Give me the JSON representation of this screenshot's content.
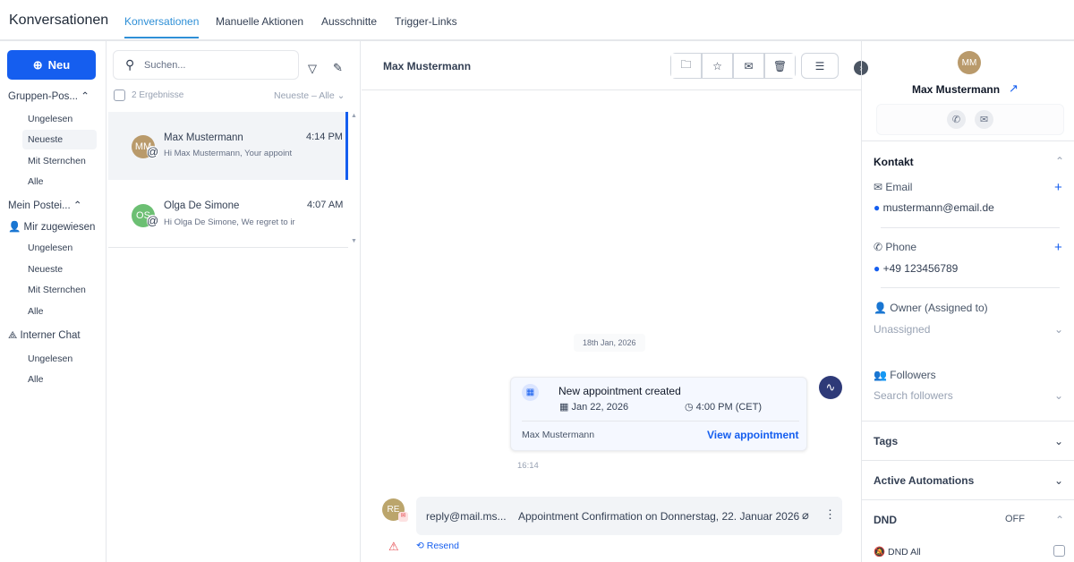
{
  "header": {
    "title": "Konversationen",
    "tabs": [
      "Konversationen",
      "Manuelle Aktionen",
      "Ausschnitte",
      "Trigger-Links"
    ]
  },
  "sidebar": {
    "new_label": "Neu",
    "group_label": "Gruppen-Pos...",
    "group_items": [
      "Ungelesen",
      "Neueste",
      "Mit Sternchen",
      "Alle"
    ],
    "inbox_label": "Mein Postei...",
    "assigned_label": "Mir zugewiesen",
    "assigned_items": [
      "Ungelesen",
      "Neueste",
      "Mit Sternchen",
      "Alle"
    ],
    "internal_label": "Interner Chat",
    "internal_items": [
      "Ungelesen",
      "Alle"
    ]
  },
  "list": {
    "search_placeholder": "Suchen...",
    "results": "2 Ergebnisse",
    "sort": "Neueste – Alle",
    "conversations": [
      {
        "initials": "MM",
        "name": "Max Mustermann",
        "time": "4:14 PM",
        "preview": "Hi Max Mustermann, Your appoint",
        "color": "#b99a6b"
      },
      {
        "initials": "OS",
        "name": "Olga De Simone",
        "time": "4:07 AM",
        "preview": "Hi Olga De Simone, We regret to ir",
        "color": "#6cbf73"
      }
    ]
  },
  "main": {
    "contact_name": "Max Mustermann",
    "date_divider": "18th Jan, 2026",
    "appointment": {
      "title": "New appointment created",
      "date": "Jan 22, 2026",
      "time": "4:00 PM (CET)",
      "contact": "Max Mustermann",
      "link": "View appointment",
      "timestamp": "16:14"
    },
    "email": {
      "initials": "RE",
      "from": "reply@mail.ms...",
      "subject": "Appointment Confirmation on Donnerstag, 22. Januar 2026",
      "resend": "Resend"
    }
  },
  "contact": {
    "initials": "MM",
    "name": "Max Mustermann",
    "section": "Kontakt",
    "email_label": "Email",
    "email": "mustermann@email.de",
    "phone_label": "Phone",
    "phone": "+49 123456789",
    "owner_label": "Owner (Assigned to)",
    "owner_value": "Unassigned",
    "followers_label": "Followers",
    "followers_placeholder": "Search followers",
    "tags": "Tags",
    "automations": "Active Automations",
    "dnd": "DND",
    "dnd_status": "OFF",
    "dnd_all": "DND All"
  }
}
